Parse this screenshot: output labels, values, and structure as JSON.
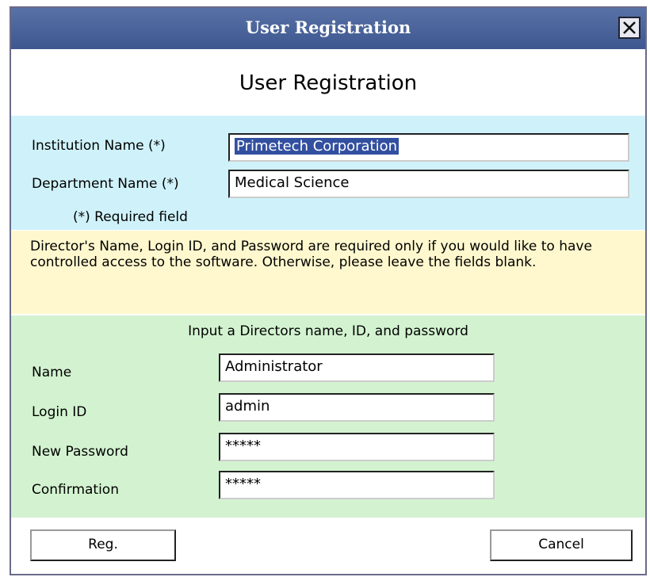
{
  "window": {
    "title": "User Registration"
  },
  "heading": "User Registration",
  "institution": {
    "institution_label": "Institution Name (*)",
    "institution_value": "Primetech Corporation",
    "department_label": "Department Name (*)",
    "department_value": "Medical Science",
    "required_note": "(*) Required field"
  },
  "notice": "Director's Name, Login ID, and Password are required only if you would like to have controlled access to the software. Otherwise, please leave the fields blank.",
  "director": {
    "section_title": "Input a Directors name, ID, and password",
    "name_label": "Name",
    "name_value": "Administrator",
    "login_label": "Login ID",
    "login_value": "admin",
    "password_label": "New Password",
    "password_value": "*****",
    "confirm_label": "Confirmation",
    "confirm_value": "*****"
  },
  "buttons": {
    "register": "Reg.",
    "cancel": "Cancel"
  },
  "icons": {
    "close": "close-icon"
  }
}
